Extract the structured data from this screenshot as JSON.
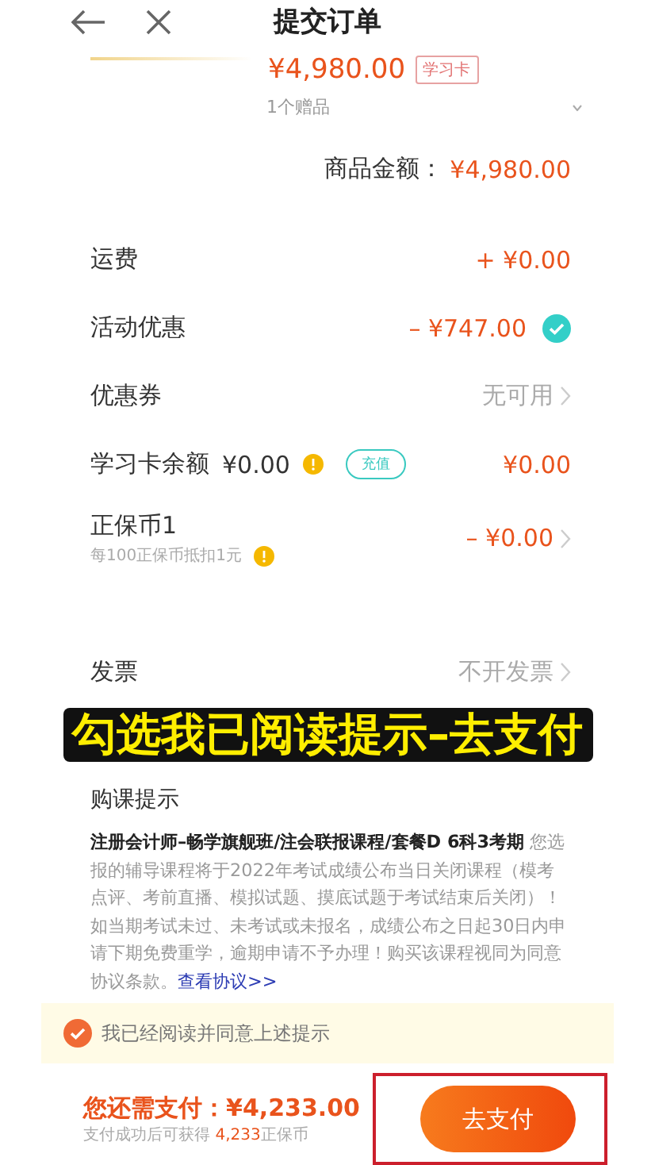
{
  "header": {
    "title": "提交订单"
  },
  "product": {
    "price": "¥4,980.00",
    "tag": "学习卡",
    "gifts": "1个赠品"
  },
  "subtotal": {
    "label": "商品金额：",
    "value": "¥4,980.00"
  },
  "rows": [
    {
      "kind": "plain",
      "label": "运费",
      "value": "+ ¥0.00"
    },
    {
      "kind": "check",
      "label": "活动优惠",
      "value": "– ¥747.00",
      "checked": true
    },
    {
      "kind": "link",
      "label": "优惠券",
      "value": "无可用",
      "muted": true
    },
    {
      "kind": "card",
      "label": "学习卡余额",
      "balance": "¥0.00",
      "button": "充值",
      "value": "¥0.00"
    },
    {
      "kind": "coin",
      "label": "正保币1",
      "sub": "每100正保币抵扣1元",
      "value": "– ¥0.00"
    },
    {
      "kind": "link",
      "label": "发票",
      "value": "不开发票",
      "muted": true
    }
  ],
  "caption": "勾选我已阅读提示–去支付",
  "notice": {
    "title": "购课提示",
    "course": "注册会计师–畅学旗舰班/注会联报课程/套餐D 6科3考期",
    "text": " 您选报的辅导课程将于2022年考试成绩公布当日关闭课程（模考点评、考前直播、模拟试题、摸底试题于考试结束后关闭）！如当期考试未过、未考试或未报名，成绩公布之日起30日内申请下期免费重学，逾期申请不予办理！购买该课程视同为同意协议条款。",
    "link": "查看协议>>"
  },
  "agree": {
    "label": "我已经阅读并同意上述提示",
    "checked": true
  },
  "footer": {
    "label": "您还需支付：",
    "amount": "¥4,233.00",
    "reward_prefix": "支付成功后可获得 ",
    "reward_amount": "4,233",
    "reward_suffix": "正保币",
    "button": "去支付",
    "highlighted": true
  }
}
